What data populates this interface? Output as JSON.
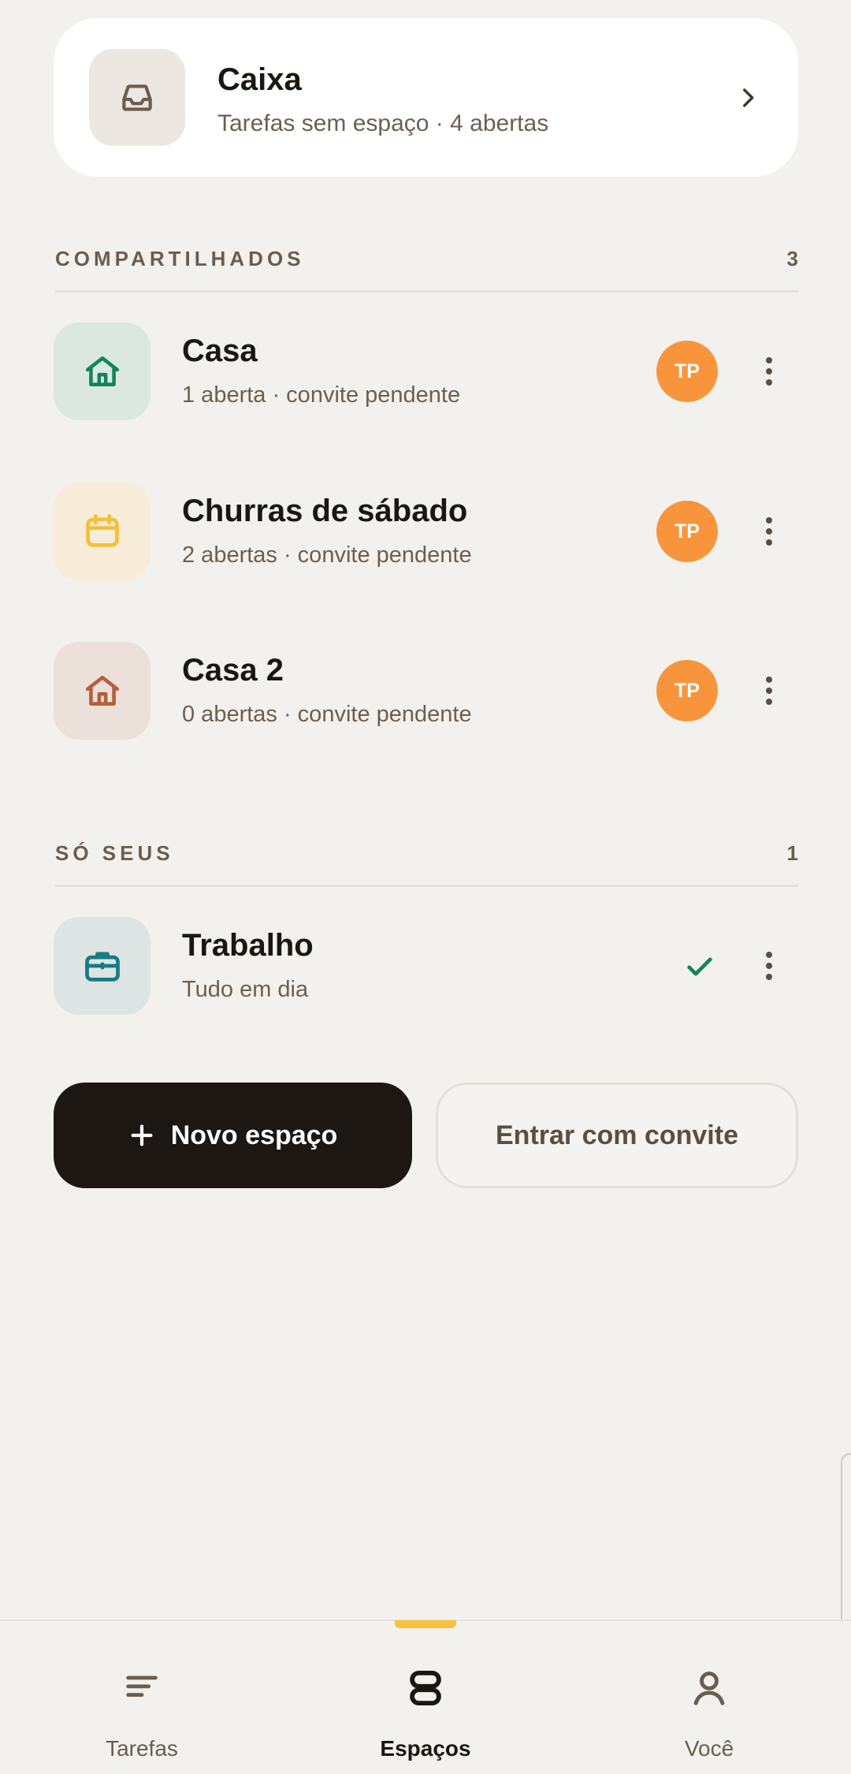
{
  "inbox": {
    "title": "Caixa",
    "subtitle": "Tarefas sem espaço · 4 abertas",
    "icon": "inbox-icon"
  },
  "shared": {
    "title": "COMPARTILHADOS",
    "count": "3",
    "items": [
      {
        "name": "Casa",
        "subtitle": "1 aberta · convite pendente",
        "icon": "home-icon",
        "color": "#12845c",
        "tile": "#dbe8e2",
        "avatar": "TP"
      },
      {
        "name": "Churras de sábado",
        "subtitle": "2 abertas · convite pendente",
        "icon": "calendar-icon",
        "color": "#f3c03c",
        "tile": "#f6ecd8",
        "avatar": "TP"
      },
      {
        "name": "Casa 2",
        "subtitle": "0 abertas · convite pendente",
        "icon": "home-icon",
        "color": "#b4603b",
        "tile": "#ece1da",
        "avatar": "TP"
      }
    ]
  },
  "own": {
    "title": "SÓ SEUS",
    "count": "1",
    "items": [
      {
        "name": "Trabalho",
        "subtitle": "Tudo em dia",
        "icon": "briefcase-icon",
        "color": "#197b82",
        "tile": "#dce5e3",
        "status": "check-icon"
      }
    ]
  },
  "actions": {
    "new_space": "Novo espaço",
    "join_invite": "Entrar com convite"
  },
  "nav": {
    "items": [
      {
        "label": "Tarefas",
        "icon": "lines-icon"
      },
      {
        "label": "Espaços",
        "icon": "spaces-icon",
        "active": true
      },
      {
        "label": "Você",
        "icon": "person-icon"
      }
    ],
    "accent": "#f7c23c"
  }
}
